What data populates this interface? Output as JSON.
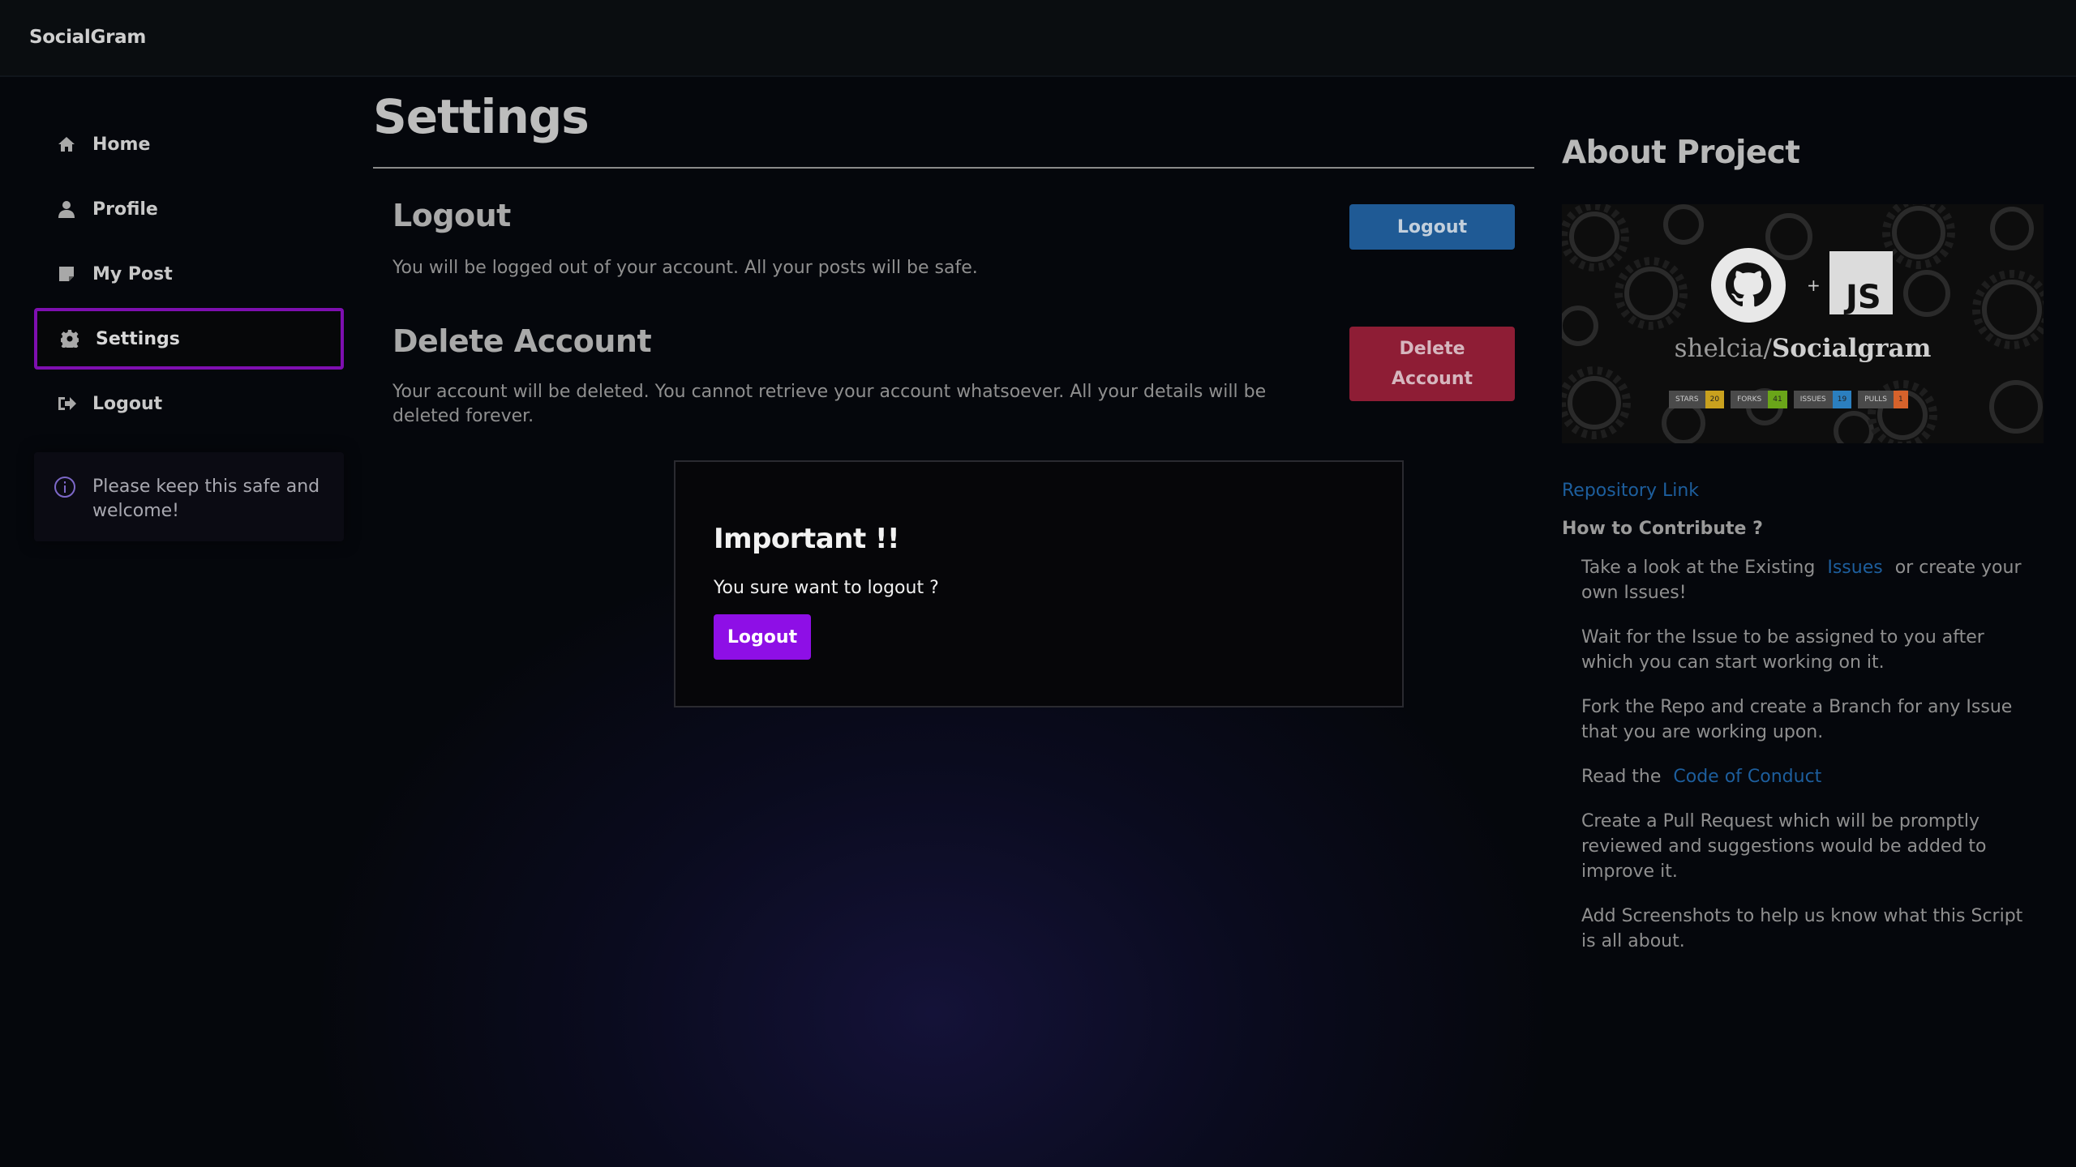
{
  "app": {
    "brand": "SocialGram"
  },
  "sidebar": {
    "items": [
      {
        "label": "Home",
        "icon": "home-icon"
      },
      {
        "label": "Profile",
        "icon": "user-icon"
      },
      {
        "label": "My Post",
        "icon": "post-icon"
      },
      {
        "label": "Settings",
        "icon": "gear-icon",
        "active": true
      },
      {
        "label": "Logout",
        "icon": "logout-icon"
      }
    ],
    "info": "Please keep this safe and welcome!"
  },
  "main": {
    "title": "Settings",
    "logout": {
      "heading": "Logout",
      "description": "You will be logged out of your account. All your posts will be safe.",
      "button": "Logout"
    },
    "delete": {
      "heading": "Delete Account",
      "description": "Your account will be deleted. You cannot retrieve your account whatsoever. All your details will be deleted forever.",
      "button_line1": "Delete",
      "button_line2": "Account"
    }
  },
  "modal": {
    "title": "Important !!",
    "message": "You sure want to logout ?",
    "button": "Logout"
  },
  "about": {
    "title": "About Project",
    "banner": {
      "owner": "shelcia/",
      "repo": "Socialgram",
      "plus": "+",
      "js": "JS",
      "badges": [
        {
          "key": "STARS",
          "value": "20",
          "color": "#c9a11e"
        },
        {
          "key": "FORKS",
          "value": "41",
          "color": "#6aa519"
        },
        {
          "key": "ISSUES",
          "value": "19",
          "color": "#2b7fbf"
        },
        {
          "key": "PULLS",
          "value": "1",
          "color": "#d6622b"
        }
      ]
    },
    "repo_link": "Repository Link",
    "contribute_heading": "How to Contribute ?",
    "steps": {
      "s1_before": "Take a look at the Existing",
      "s1_link": "Issues",
      "s1_after": "or create your own Issues!",
      "s2": "Wait for the Issue to be assigned to you after which you can start working on it.",
      "s3": "Fork the Repo and create a Branch for any Issue that you are working upon.",
      "s4_before": "Read the",
      "s4_link": "Code of Conduct",
      "s5": "Create a Pull Request which will be promptly reviewed and suggestions would be added to improve it.",
      "s6": "Add Screenshots to help us know what this Script is all about."
    }
  },
  "colors": {
    "accent_purple": "#8e0fe6",
    "active_border": "#7e0fb0",
    "logout_blue": "#1f5a95",
    "delete_red": "#8e1d35",
    "link_blue": "#1d5e9d"
  }
}
